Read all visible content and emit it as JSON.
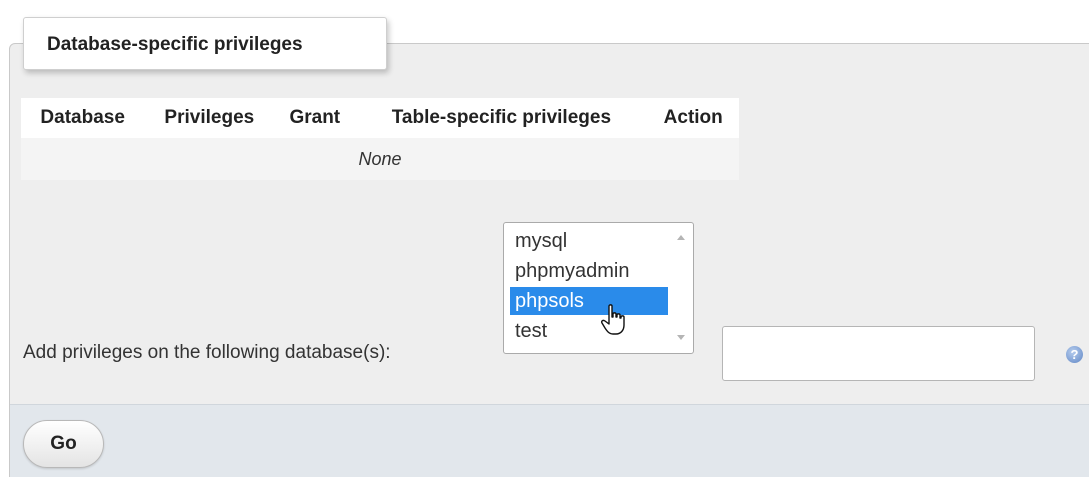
{
  "section": {
    "legend": "Database-specific privileges"
  },
  "privileges_table": {
    "columns": [
      "Database",
      "Privileges",
      "Grant",
      "Table-specific privileges",
      "Action"
    ],
    "empty_text": "None"
  },
  "add_privileges": {
    "label": "Add privileges on the following database(s):",
    "database_options": [
      "mysql",
      "phpmyadmin",
      "phpsols",
      "test"
    ],
    "selected_option": "phpsols",
    "text_value": ""
  },
  "footer": {
    "go_label": "Go"
  },
  "icons": {
    "help": "help-icon",
    "cursor": "hand-cursor-icon",
    "scroll_up": "scroll-up-arrow-icon",
    "scroll_down": "scroll-down-arrow-icon"
  },
  "colors": {
    "selection": "#2a8bea",
    "panel_bg": "#eeeeee",
    "footer_bg": "#e2e7ec",
    "help_icon": "#5f86c5"
  }
}
